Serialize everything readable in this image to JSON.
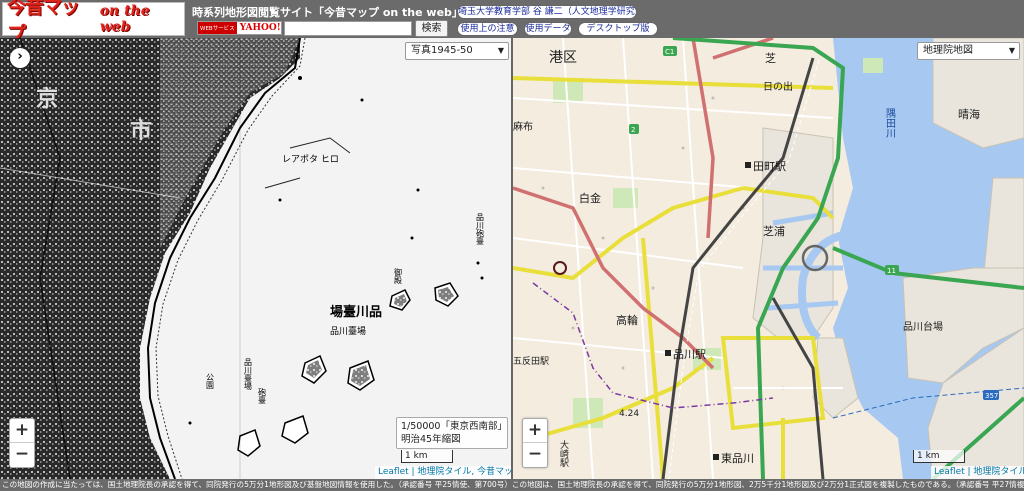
{
  "header": {
    "logo_jp": "今昔マップ",
    "logo_en": "on the web",
    "site_title": "時系列地形図閲覧サイト「今昔マップ on the web」",
    "yahoo_badge_label": "WEBサービス",
    "yahoo_badge_logo": "YAHOO!",
    "search_placeholder": "",
    "search_button": "検索",
    "author_button": "埼玉大学教育学部 谷 謙二（人文地理学研究室）",
    "usage_notes_button": "使用上の注意",
    "usage_data_button": "使用データ",
    "desktop_button": "デスクトップ版"
  },
  "left_map": {
    "select_value": "写真1945-50",
    "toggle_label": "›",
    "info_line1": "1/50000「東京西南部」",
    "info_line2": "明治45年縮図",
    "scale_label": "1 km",
    "zoom_in": "+",
    "zoom_out": "−",
    "attribution": "Leaflet | 地理院タイル, 今昔マップ",
    "labels": {
      "kyo": "京",
      "shi": "市",
      "senro": "レアポタ ヒロ",
      "daiba": "場臺川品",
      "sheet_caption": "品川臺場"
    }
  },
  "right_map": {
    "select_value": "地理院地図",
    "scale_label": "1 km",
    "zoom_in": "+",
    "zoom_out": "−",
    "attribution": "Leaflet | 地理院タイル",
    "labels": {
      "minato": "港区",
      "shiba": "芝",
      "hinode": "日の出",
      "harumi": "晴海",
      "tamachi_station": "田町駅",
      "shirokane": "白金",
      "shibaura": "芝浦",
      "takanawa": "高輪",
      "shinagawa_station": "品川駅",
      "shinagawa_daiba": "品川台場",
      "higashi_shinagawa": "東品川",
      "osaki_station": "大崎駅",
      "gotanda_station": "五反田駅",
      "azabu": "麻布",
      "sumidagawa": "隅田川",
      "route_c1": "C1",
      "route_2": "2",
      "route_11": "11",
      "route_357": "357",
      "elev": "4.24"
    }
  },
  "footer": {
    "text": "この地図の作成に当たっては、国土地理院長の承認を得て、同院発行の5万分1地形図及び基盤地図情報を使用した。（承認番号 平25情使、第700号）この地図は、国土地理院長の承認を得て、同院発行の5万分1地形図、2万5千分1地形図及び2万分1正式図を複製したものである。（承認番号 平27情複、第"
  },
  "colors": {
    "header_bg": "#6b6b6b",
    "logo_red": "#e0241b",
    "link_blue": "#1a2a9a",
    "sea": "#a7c8f0",
    "expressway": "#3aa652",
    "national_road": "#d07070",
    "prefectural_road": "#e8df3a",
    "rail_jr": "#444444"
  }
}
